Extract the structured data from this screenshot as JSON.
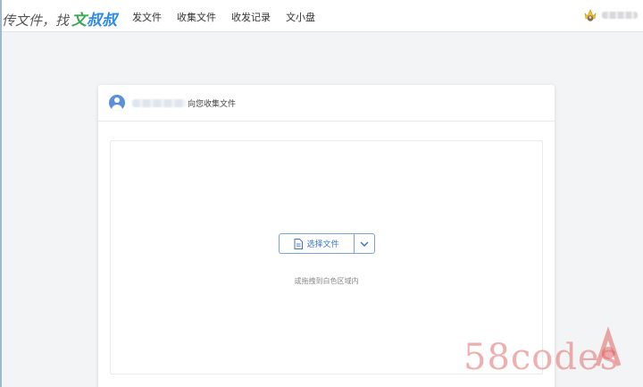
{
  "header": {
    "logo_main": "传文件，找",
    "logo_brand_1": "文",
    "logo_brand_2": "叔叔",
    "nav": [
      "发文件",
      "收集文件",
      "收发记录",
      "文小盘"
    ],
    "user_icon": "crown-avatar-icon"
  },
  "card": {
    "header_text": "向您收集文件",
    "sender_avatar_icon": "user-avatar-icon",
    "select_button_label": "选择文件",
    "select_button_icon": "file-icon",
    "dropdown_icon": "chevron-down-icon",
    "drop_hint": "或拖拽到白色区域内"
  },
  "watermark": {
    "text": "58codes"
  },
  "colors": {
    "brand_green": "#3aa853",
    "brand_blue": "#2d8be8",
    "button_border": "#7aa3d8",
    "button_text": "#3a74c4",
    "watermark": "#e26e6e"
  }
}
